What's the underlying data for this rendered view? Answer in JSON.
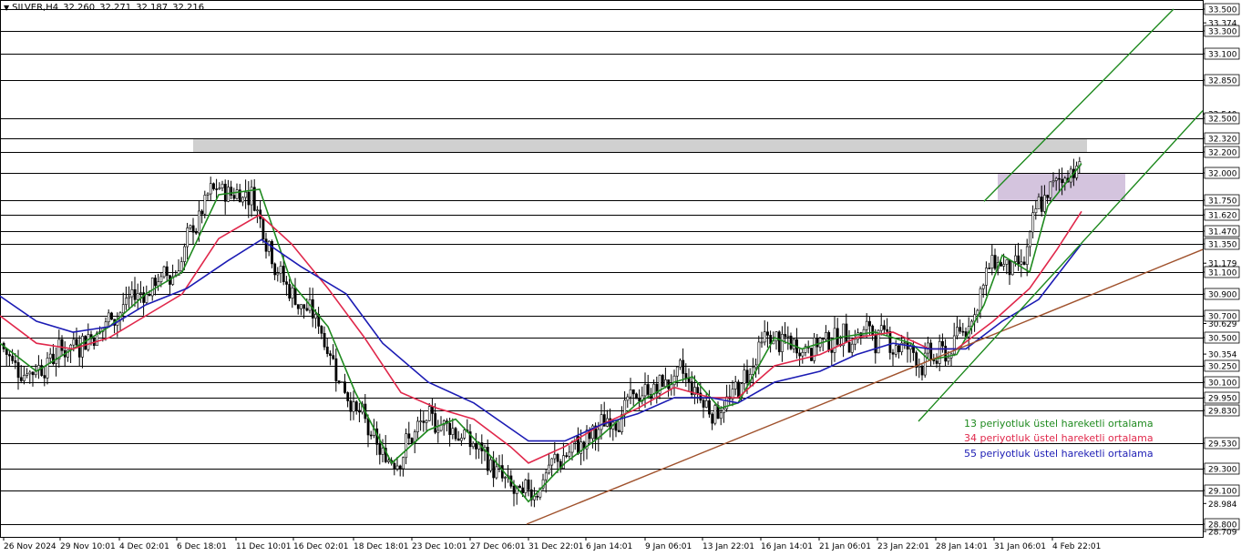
{
  "ticker": {
    "symbol": "SILVER,H4",
    "open": "32.260",
    "high": "32.271",
    "low": "32.187",
    "close": "32.216"
  },
  "legend": [
    {
      "label": "13 periyotluk üstel hareketli ortalama",
      "color": "#1f8a1f"
    },
    {
      "label": "34 periyotluk üstel hareketli ortalama",
      "color": "#e0284b"
    },
    {
      "label": "55 periyotluk üstel hareketli ortalama",
      "color": "#1c1cb4"
    }
  ],
  "chart_data": {
    "type": "candlestick",
    "symbol": "SILVER",
    "timeframe": "H4",
    "ylim": [
      28.709,
      33.5
    ],
    "y_ticks": [
      "33.500",
      "33.374",
      "33.300",
      "33.100",
      "32.850",
      "32.540",
      "32.500",
      "32.320",
      "32.200",
      "32.000",
      "31.750",
      "31.620",
      "31.470",
      "31.350",
      "31.179",
      "31.100",
      "30.900",
      "30.700",
      "30.629",
      "30.500",
      "30.354",
      "30.250",
      "30.100",
      "29.950",
      "29.830",
      "29.530",
      "29.300",
      "29.100",
      "28.984",
      "28.800",
      "28.709"
    ],
    "horizontal_levels": [
      33.5,
      33.3,
      33.1,
      32.85,
      32.5,
      32.32,
      32.2,
      32.0,
      31.75,
      31.62,
      31.47,
      31.35,
      31.1,
      30.9,
      30.7,
      30.5,
      30.25,
      30.1,
      29.95,
      29.83,
      29.53,
      29.3,
      29.1,
      28.8
    ],
    "x_labels": [
      "26 Nov 2024",
      "29 Nov 10:01",
      "4 Dec 02:01",
      "6 Dec 18:01",
      "11 Dec 10:01",
      "16 Dec 02:01",
      "18 Dec 18:01",
      "23 Dec 10:01",
      "27 Dec 06:01",
      "31 Dec 22:01",
      "6 Jan 14:01",
      "9 Jan 06:01",
      "13 Jan 22:01",
      "16 Jan 14:01",
      "21 Jan 06:01",
      "23 Jan 22:01",
      "28 Jan 14:01",
      "31 Jan 06:01",
      "4 Feb 22:01"
    ],
    "series": [
      {
        "name": "13 periyotluk üstel hareketli ortalama",
        "color": "#1f8a1f",
        "points": [
          [
            0,
            30.45
          ],
          [
            40,
            30.2
          ],
          [
            80,
            30.4
          ],
          [
            120,
            30.6
          ],
          [
            160,
            30.9
          ],
          [
            200,
            31.1
          ],
          [
            240,
            31.8
          ],
          [
            285,
            31.85
          ],
          [
            320,
            31.0
          ],
          [
            360,
            30.6
          ],
          [
            390,
            30.0
          ],
          [
            430,
            29.35
          ],
          [
            470,
            29.65
          ],
          [
            500,
            29.75
          ],
          [
            540,
            29.4
          ],
          [
            580,
            29.0
          ],
          [
            620,
            29.35
          ],
          [
            660,
            29.6
          ],
          [
            700,
            29.9
          ],
          [
            740,
            30.1
          ],
          [
            760,
            30.15
          ],
          [
            790,
            29.85
          ],
          [
            810,
            29.9
          ],
          [
            850,
            30.5
          ],
          [
            880,
            30.4
          ],
          [
            920,
            30.5
          ],
          [
            960,
            30.55
          ],
          [
            1000,
            30.45
          ],
          [
            1020,
            30.3
          ],
          [
            1050,
            30.35
          ],
          [
            1080,
            30.8
          ],
          [
            1100,
            31.25
          ],
          [
            1130,
            31.1
          ],
          [
            1150,
            31.7
          ],
          [
            1187,
            32.09
          ]
        ]
      },
      {
        "name": "34 periyotluk üstel hareketli ortalama",
        "color": "#e0284b",
        "points": [
          [
            0,
            30.7
          ],
          [
            40,
            30.45
          ],
          [
            80,
            30.4
          ],
          [
            120,
            30.5
          ],
          [
            160,
            30.7
          ],
          [
            200,
            30.9
          ],
          [
            240,
            31.4
          ],
          [
            285,
            31.62
          ],
          [
            320,
            31.35
          ],
          [
            360,
            30.95
          ],
          [
            400,
            30.5
          ],
          [
            440,
            30.0
          ],
          [
            480,
            29.85
          ],
          [
            520,
            29.75
          ],
          [
            560,
            29.5
          ],
          [
            580,
            29.35
          ],
          [
            620,
            29.5
          ],
          [
            660,
            29.7
          ],
          [
            700,
            29.85
          ],
          [
            740,
            30.05
          ],
          [
            780,
            29.95
          ],
          [
            810,
            29.95
          ],
          [
            850,
            30.25
          ],
          [
            900,
            30.35
          ],
          [
            940,
            30.5
          ],
          [
            980,
            30.55
          ],
          [
            1020,
            30.4
          ],
          [
            1050,
            30.4
          ],
          [
            1090,
            30.65
          ],
          [
            1130,
            30.95
          ],
          [
            1160,
            31.3
          ],
          [
            1187,
            31.65
          ]
        ]
      },
      {
        "name": "55 periyotluk üstel hareketli ortalama",
        "color": "#1c1cb4",
        "points": [
          [
            0,
            30.88
          ],
          [
            40,
            30.65
          ],
          [
            80,
            30.55
          ],
          [
            120,
            30.6
          ],
          [
            160,
            30.8
          ],
          [
            205,
            30.95
          ],
          [
            250,
            31.2
          ],
          [
            287,
            31.39
          ],
          [
            330,
            31.15
          ],
          [
            380,
            30.9
          ],
          [
            420,
            30.45
          ],
          [
            470,
            30.1
          ],
          [
            520,
            29.9
          ],
          [
            580,
            29.55
          ],
          [
            620,
            29.55
          ],
          [
            660,
            29.7
          ],
          [
            700,
            29.8
          ],
          [
            740,
            29.95
          ],
          [
            780,
            29.95
          ],
          [
            810,
            29.9
          ],
          [
            850,
            30.1
          ],
          [
            900,
            30.2
          ],
          [
            940,
            30.35
          ],
          [
            980,
            30.45
          ],
          [
            1020,
            30.4
          ],
          [
            1060,
            30.4
          ],
          [
            1100,
            30.65
          ],
          [
            1140,
            30.85
          ],
          [
            1187,
            31.35
          ]
        ]
      }
    ],
    "trendlines": [
      {
        "color": "#a0522d",
        "from": [
          578,
          28.8
        ],
        "to": [
          1320,
          31.3
        ]
      },
      {
        "color": "#1f8a1f",
        "from": [
          1008,
          29.73
        ],
        "to": [
          1320,
          32.57
        ]
      },
      {
        "color": "#1f8a1f",
        "from": [
          1080,
          31.74
        ],
        "to": [
          1288,
          33.5
        ]
      }
    ],
    "zones": [
      {
        "color": "#d0d0d0",
        "from_x": 212,
        "to_x": 1193,
        "low": 32.2,
        "high": 32.32
      },
      {
        "color": "#d4c4de",
        "from_x": 1095,
        "to_x": 1235,
        "low": 31.75,
        "high": 32.0
      }
    ]
  }
}
